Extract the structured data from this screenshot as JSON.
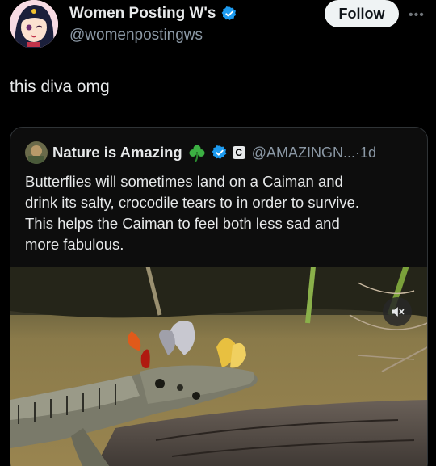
{
  "post": {
    "author_name": "Women Posting W's",
    "handle": "@womenpostingws",
    "follow_label": "Follow",
    "more_icon": "more-horizontal-icon",
    "text": "this diva omg"
  },
  "quote": {
    "author_name": "Nature is Amazing",
    "emoji_icon": "shamrock-icon",
    "badge_letter": "C",
    "meta": "@AMAZINGN...·1d",
    "lines": [
      "Butterflies will sometimes land on a Caiman and",
      "drink its salty, crocodile tears to in order to survive.",
      "This helps the Caiman to feel both less sad and",
      "more fabulous."
    ],
    "media_icon": "mute-icon"
  },
  "colors": {
    "background": "#000000",
    "verified": "#1d9bf0",
    "muted_text": "#8b98a5",
    "follow_bg": "#eff3f4"
  }
}
